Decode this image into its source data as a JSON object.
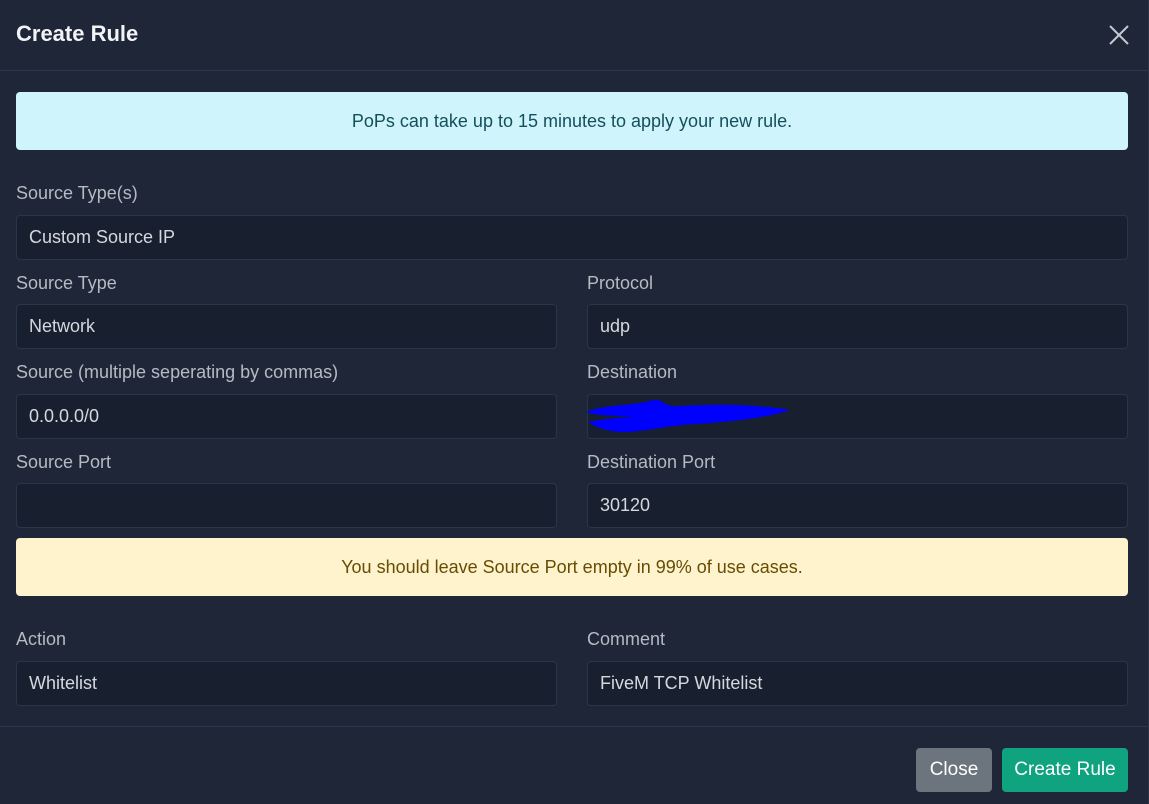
{
  "modal": {
    "title": "Create Rule"
  },
  "alerts": {
    "info": "PoPs can take up to 15 minutes to apply your new rule.",
    "warning": "You should leave Source Port empty in 99% of use cases."
  },
  "form": {
    "source_types": {
      "label": "Source Type(s)",
      "value": "Custom Source IP"
    },
    "source_type": {
      "label": "Source Type",
      "value": "Network"
    },
    "protocol": {
      "label": "Protocol",
      "value": "udp"
    },
    "source": {
      "label": "Source (multiple seperating by commas)",
      "value": "0.0.0.0/0"
    },
    "destination": {
      "label": "Destination",
      "value": ""
    },
    "source_port": {
      "label": "Source Port",
      "value": ""
    },
    "destination_port": {
      "label": "Destination Port",
      "value": "30120"
    },
    "action": {
      "label": "Action",
      "value": "Whitelist"
    },
    "comment": {
      "label": "Comment",
      "value": "FiveM TCP Whitelist"
    }
  },
  "footer": {
    "close_label": "Close",
    "create_label": "Create Rule"
  },
  "colors": {
    "background": "#1e2638",
    "info_bg": "#cff4fc",
    "warning_bg": "#fff3cd",
    "close_button": "#6c757d",
    "create_button": "#10a37f",
    "redaction": "#0000ff"
  },
  "icons": {
    "close": "close-icon"
  }
}
